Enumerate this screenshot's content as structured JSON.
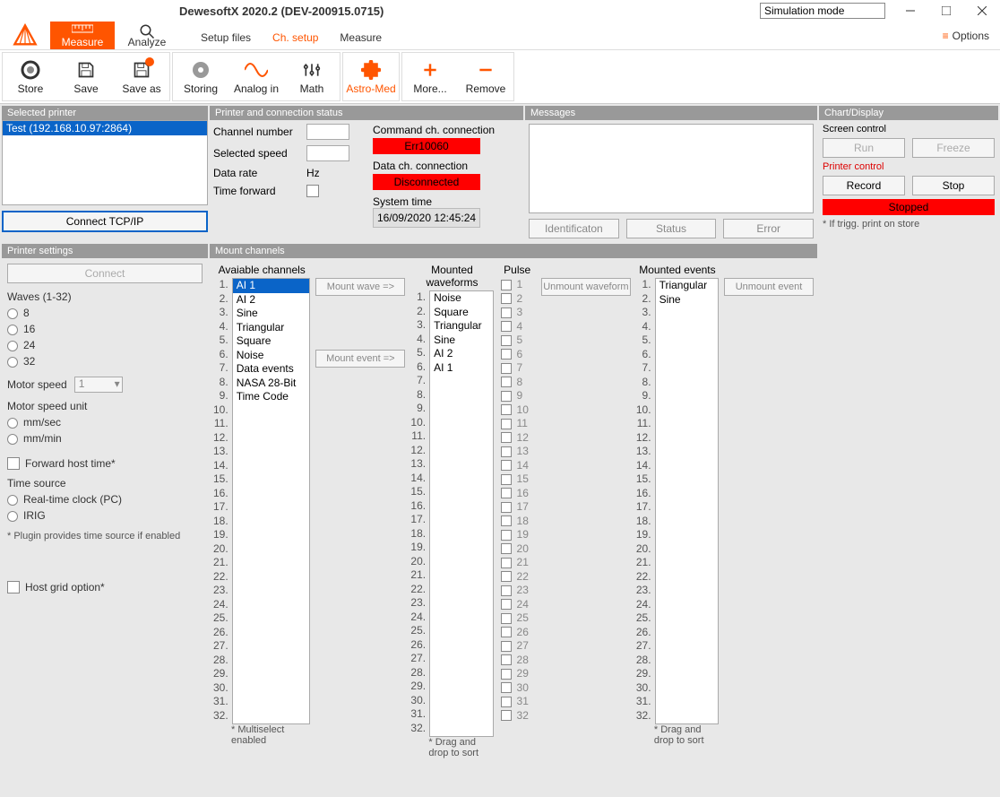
{
  "app_title": "DewesoftX 2020.2 (DEV-200915.0715)",
  "simulation_mode": "Simulation mode",
  "options_label": "Options",
  "ribbon": {
    "measure": "Measure",
    "analyze": "Analyze",
    "subtabs": {
      "setup_files": "Setup files",
      "ch_setup": "Ch. setup",
      "measure": "Measure"
    }
  },
  "toolbar": {
    "store": "Store",
    "save": "Save",
    "saveas": "Save as",
    "storing": "Storing",
    "analogin": "Analog in",
    "math": "Math",
    "astromed": "Astro-Med",
    "more": "More...",
    "remove": "Remove"
  },
  "panels": {
    "selected_printer": "Selected printer",
    "status": "Printer and connection status",
    "messages": "Messages",
    "chart": "Chart/Display",
    "settings": "Printer settings",
    "mount": "Mount channels"
  },
  "selected": {
    "item": "Test (192.168.10.97:2864)",
    "connect_btn": "Connect TCP/IP"
  },
  "status": {
    "channel_number": "Channel number",
    "selected_speed": "Selected speed",
    "data_rate": "Data rate",
    "hz": "Hz",
    "time_forward": "Time forward",
    "cmd_conn": "Command ch. connection",
    "cmd_val": "Err10060",
    "data_conn": "Data ch. connection",
    "data_val": "Disconnected",
    "system_time": "System time",
    "time_val": "16/09/2020 12:45:24",
    "identification": "Identificaton",
    "status_btn": "Status",
    "error_btn": "Error"
  },
  "chart": {
    "screen_control": "Screen control",
    "run": "Run",
    "freeze": "Freeze",
    "printer_control": "Printer control",
    "record": "Record",
    "stop": "Stop",
    "stopped": "Stopped",
    "trig_note": "* If trigg. print on store"
  },
  "settings": {
    "connect": "Connect",
    "waves_title": "Waves (1-32)",
    "w8": "8",
    "w16": "16",
    "w24": "24",
    "w32": "32",
    "motor_speed": "Motor speed",
    "motor_speed_val": "1",
    "motor_speed_unit": "Motor speed unit",
    "mmsec": "mm/sec",
    "mmmin": "mm/min",
    "forward_host": "Forward host time*",
    "time_source": "Time source",
    "rtc": "Real-time clock (PC)",
    "irig": "IRIG",
    "plugin_note": "* Plugin provides time source if enabled",
    "host_grid": "Host grid option*"
  },
  "mount": {
    "avail": "Avaiable channels",
    "mounted_wave": "Mounted waveforms",
    "pulse": "Pulse",
    "mounted_events": "Mounted events",
    "mount_wave": "Mount  wave =>",
    "mount_event": "Mount event =>",
    "unmount_wave": "Unmount waveform",
    "unmount_event": "Unmount event",
    "avail_items": [
      "AI 1",
      "AI 2",
      "Sine",
      "Triangular",
      "Square",
      "Noise",
      "Data events",
      "NASA 28-Bit Time Code"
    ],
    "wave_items": [
      "Noise",
      "Square",
      "Triangular",
      "Sine",
      "AI 2",
      "AI 1"
    ],
    "event_items": [
      "Triangular",
      "Sine"
    ],
    "foot_multi": "* Multiselect enabled",
    "foot_drag": "* Drag and drop to sort"
  }
}
